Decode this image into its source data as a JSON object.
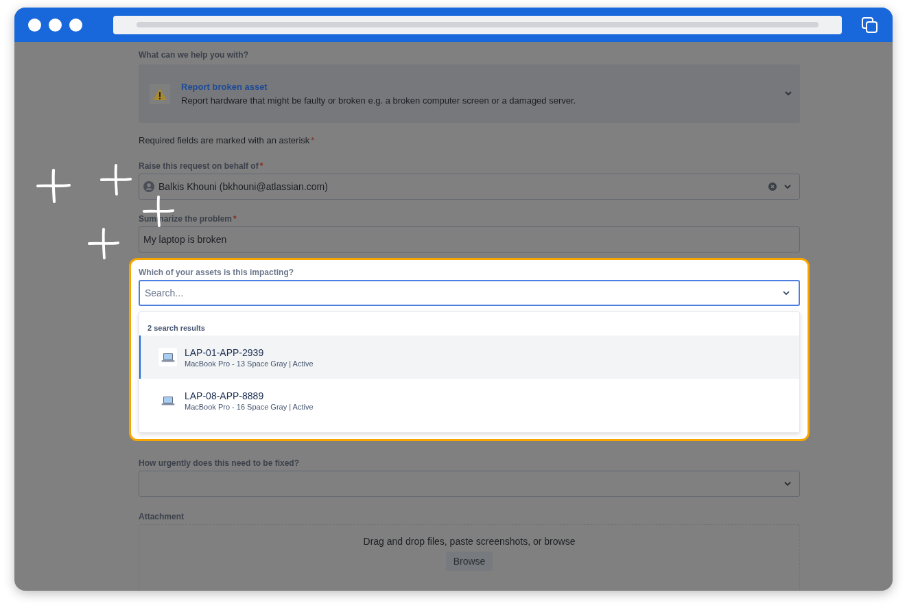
{
  "request_type": {
    "label": "What can we help you with?",
    "title": "Report broken asset",
    "description": "Report hardware that might be faulty or broken e.g. a broken computer screen or a damaged server."
  },
  "required_note": {
    "text": "Required fields are marked with an asterisk",
    "mark": "*"
  },
  "fields": [
    {
      "kind": "person",
      "label": "Raise this request on behalf of",
      "required_mark": "*",
      "value": "Balkis Khouni (bkhouni@atlassian.com)"
    },
    {
      "kind": "text",
      "label": "Summarize the problem",
      "required_mark": "*",
      "value": "My laptop is broken"
    },
    {
      "kind": "asset-search",
      "label": "Which of your assets is this impacting?",
      "placeholder": "Search...",
      "results_count": "2 search results",
      "results": [
        {
          "name": "LAP-01-APP-2939",
          "detail": "MacBook Pro - 13 Space Gray | Active",
          "selected": true
        },
        {
          "name": "LAP-08-APP-8889",
          "detail": "MacBook Pro - 16 Space Gray | Active",
          "selected": false
        }
      ]
    },
    {
      "kind": "select",
      "label": "How urgently does this need to be fixed?"
    },
    {
      "kind": "attachment",
      "label": "Attachment",
      "prompt": "Drag and drop files, paste screenshots, or browse",
      "button": "Browse"
    }
  ]
}
